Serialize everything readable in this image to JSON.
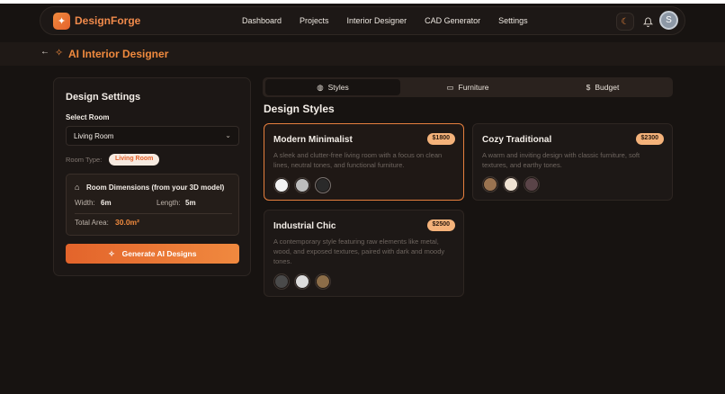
{
  "nav": {
    "brand": "DesignForge",
    "links": [
      "Dashboard",
      "Projects",
      "Interior Designer",
      "CAD Generator",
      "Settings"
    ],
    "avatar_initial": "S"
  },
  "header": {
    "title": "AI Interior Designer"
  },
  "settings": {
    "title": "Design Settings",
    "select_label": "Select Room",
    "selected_room": "Living Room",
    "room_type_label": "Room Type:",
    "room_type_value": "Living Room",
    "dimensions_title": "Room Dimensions (from your 3D model)",
    "width_label": "Width:",
    "width_value": "6m",
    "length_label": "Length:",
    "length_value": "5m",
    "total_label": "Total Area:",
    "total_value": "30.0m²",
    "generate_label": "Generate AI Designs"
  },
  "tabs": [
    {
      "label": "Styles",
      "active": true
    },
    {
      "label": "Furniture",
      "active": false
    },
    {
      "label": "Budget",
      "active": false
    }
  ],
  "section_title": "Design Styles",
  "styles": [
    {
      "name": "Modern Minimalist",
      "price": "$1800",
      "description": "A sleek and clutter-free living room with a focus on clean lines, neutral tones, and functional furniture.",
      "colors": [
        "#f2f2f2",
        "#bdbdbd",
        "#2a2a2a"
      ],
      "selected": true
    },
    {
      "name": "Cozy Traditional",
      "price": "$2300",
      "description": "A warm and inviting design with classic furniture, soft textures, and earthy tones.",
      "colors": [
        "#9a7350",
        "#efe2d2",
        "#5a4448"
      ],
      "selected": false
    },
    {
      "name": "Industrial Chic",
      "price": "$2500",
      "description": "A contemporary style featuring raw elements like metal, wood, and exposed textures, paired with dark and moody tones.",
      "colors": [
        "#4a4a4a",
        "#dcdcdc",
        "#8c6d48"
      ],
      "selected": false
    }
  ],
  "colors": {
    "accent": "#f08a3e",
    "background": "#171311"
  }
}
